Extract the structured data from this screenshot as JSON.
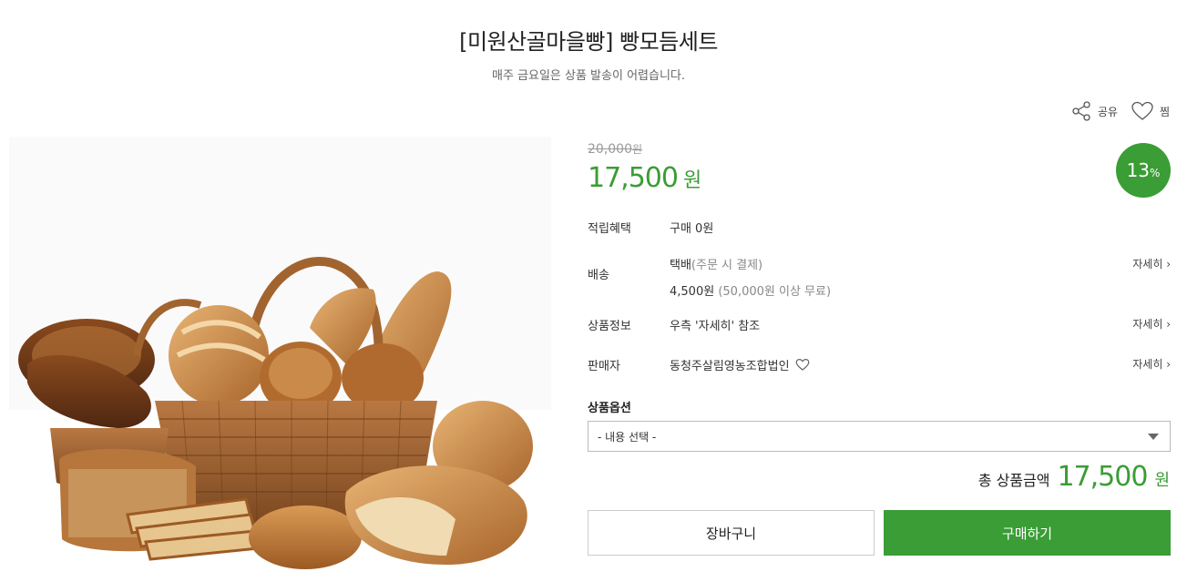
{
  "product": {
    "title": "[미원산골마을빵] 빵모듬세트",
    "subtitle": "매주 금요일은 상품 발송이 어렵습니다."
  },
  "actions": {
    "share_label": "공유",
    "wish_label": "찜"
  },
  "price": {
    "original": "20,000",
    "original_unit": "원",
    "sale": "17,500",
    "sale_unit": "원",
    "discount_value": "13",
    "discount_unit": "%"
  },
  "info": {
    "points": {
      "label": "적립혜택",
      "value": "구매 0원"
    },
    "shipping": {
      "label": "배송",
      "method": "택배",
      "method_note": "(주문 시 결제)",
      "fee": "4,500원",
      "fee_note": "(50,000원 이상 무료)",
      "more": "자세히 ›"
    },
    "product_info": {
      "label": "상품정보",
      "value": "우측 '자세히' 참조",
      "more": "자세히 ›"
    },
    "seller": {
      "label": "판매자",
      "value": "동청주살림영농조합법인",
      "more": "자세히 ›"
    }
  },
  "options": {
    "label": "상품옵션",
    "selected": "- 내용 선택 -"
  },
  "total": {
    "label": "총 상품금액",
    "value": "17,500",
    "unit": "원"
  },
  "buttons": {
    "cart": "장바구니",
    "buy": "구매하기"
  },
  "colors": {
    "accent": "#3a9d35"
  }
}
